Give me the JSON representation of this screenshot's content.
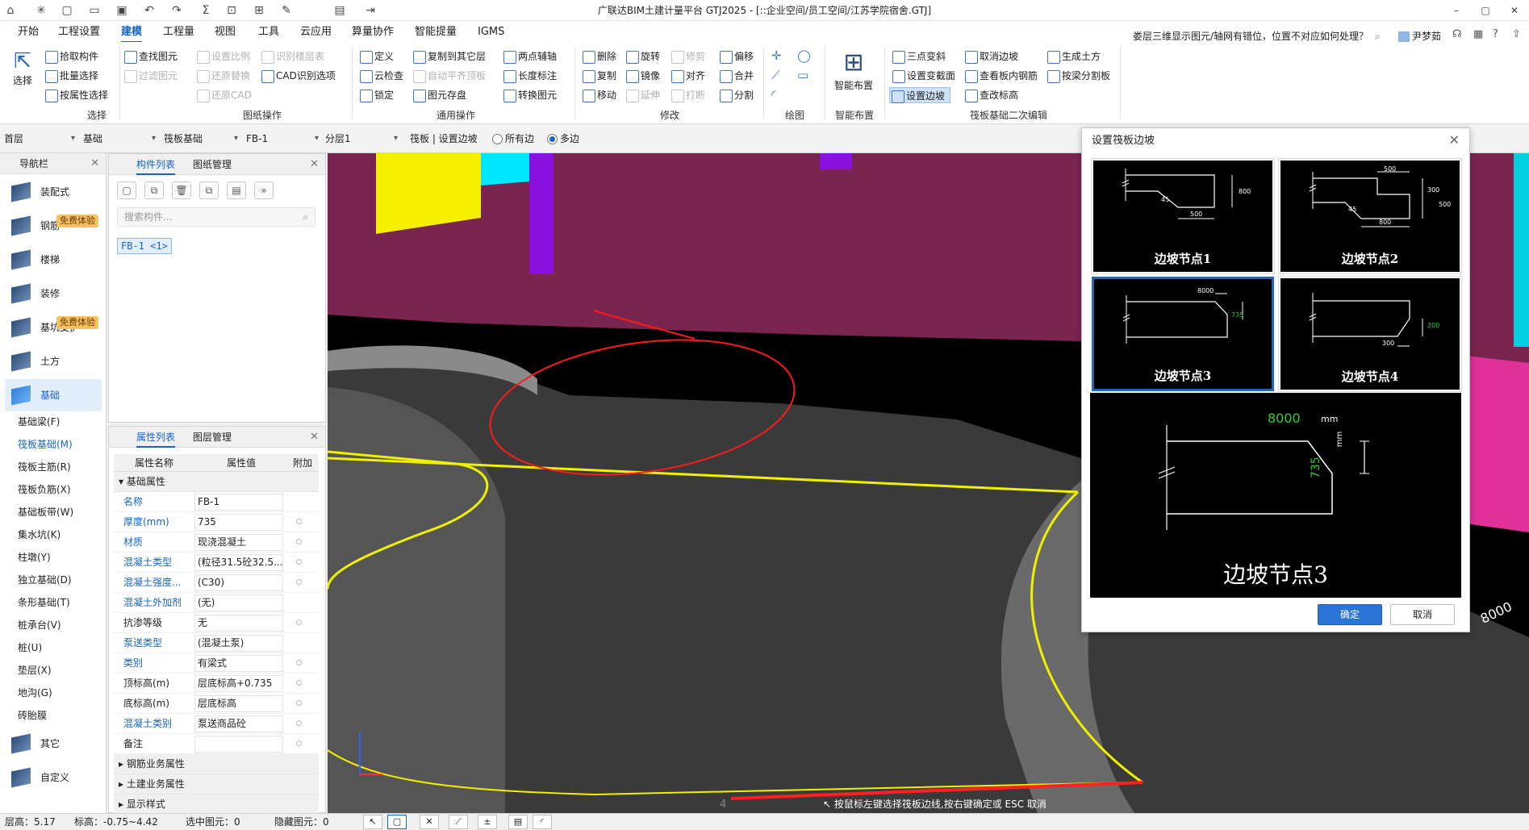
{
  "app": {
    "title": "广联达BIM土建计量平台 GTJ2025 - [::企业空间/员工空间/江苏学院宿舍.GTJ]"
  },
  "menu": {
    "tabs": [
      "开始",
      "工程设置",
      "建模",
      "工程量",
      "视图",
      "工具",
      "云应用",
      "算量协作",
      "智能提量",
      "IGMS"
    ],
    "active": "建模",
    "help": "娄层三维显示图元/轴网有错位，位置不对应如何处理？",
    "user": "尹梦茹"
  },
  "ribbon": {
    "select": {
      "big": "选择",
      "items": [
        "拾取构件",
        "批量选择",
        "按属性选择"
      ],
      "label": "选择"
    },
    "drawing": {
      "items": [
        "查找图元",
        "过滤图元",
        "设置比例",
        "还原替换",
        "还原CAD",
        "识别楼层表",
        "CAD识别选项"
      ],
      "label": "图纸操作"
    },
    "common": {
      "items": [
        "定义",
        "云检查",
        "锁定",
        "复制到其它层",
        "自动平齐顶板",
        "图元存盘",
        "两点辅轴",
        "长度标注",
        "转换图元"
      ],
      "label": "通用操作"
    },
    "modify": {
      "items": [
        "删除",
        "旋转",
        "修剪",
        "偏移",
        "复制",
        "镜像",
        "对齐",
        "合并",
        "移动",
        "延伸",
        "打断",
        "分割"
      ],
      "label": "修改"
    },
    "draw": {
      "label": "绘图"
    },
    "smart": {
      "big": "智能布置",
      "label": "智能布置"
    },
    "raft": {
      "items": [
        "三点变斜",
        "设置变截面",
        "设置边坡",
        "取消边坡",
        "查看板内钢筋",
        "查改标高",
        "生成土方",
        "按梁分割板"
      ],
      "label": "筏板基础二次编辑"
    }
  },
  "selbar": {
    "floor": "首层",
    "type": "基础",
    "subtype": "筏板基础",
    "comp": "FB-1",
    "layer": "分层1",
    "mode": "筏板 | 设置边坡",
    "opt_all": "所有边",
    "opt_multi": "多边"
  },
  "nav": {
    "title": "导航栏",
    "categories": [
      "装配式",
      "钢筋",
      "楼梯",
      "装修",
      "基坑支护",
      "土方",
      "基础",
      "其它",
      "自定义"
    ],
    "badge": "免费体验",
    "items": [
      "基础梁(F)",
      "筏板基础(M)",
      "筏板主筋(R)",
      "筏板负筋(X)",
      "基础板带(W)",
      "集水坑(K)",
      "柱墩(Y)",
      "独立基础(D)",
      "条形基础(T)",
      "桩承台(V)",
      "桩(U)",
      "垫层(X)",
      "地沟(G)",
      "砖胎膜"
    ],
    "active_item": "筏板基础(M)"
  },
  "components": {
    "tab1": "构件列表",
    "tab2": "图纸管理",
    "search_placeholder": "搜索构件...",
    "item": "FB-1 <1>"
  },
  "properties": {
    "tab1": "属性列表",
    "tab2": "图层管理",
    "headers": [
      "属性名称",
      "属性值",
      "附加"
    ],
    "group_basic": "基础属性",
    "rows": [
      {
        "name": "名称",
        "value": "FB-1"
      },
      {
        "name": "厚度(mm)",
        "value": "735"
      },
      {
        "name": "材质",
        "value": "现浇混凝土"
      },
      {
        "name": "混凝土类型",
        "value": "(粒径31.5砼32.5..."
      },
      {
        "name": "混凝土强度...",
        "value": "(C30)"
      },
      {
        "name": "混凝土外加剂",
        "value": "(无)"
      },
      {
        "name": "抗渗等级",
        "value": "无"
      },
      {
        "name": "泵送类型",
        "value": "(混凝土泵)"
      },
      {
        "name": "类别",
        "value": "有梁式"
      },
      {
        "name": "顶标高(m)",
        "value": "层底标高+0.735"
      },
      {
        "name": "底标高(m)",
        "value": "层底标高"
      },
      {
        "name": "混凝土类别",
        "value": "泵送商品砼"
      },
      {
        "name": "备注",
        "value": ""
      }
    ],
    "groups_bottom": [
      "钢筋业务属性",
      "土建业务属性",
      "显示样式"
    ]
  },
  "viewport": {
    "hint": "按鼠标左键选择筏板边线,按右键确定或 ESC 取消",
    "dim": "8000",
    "axis_label": "4"
  },
  "status": {
    "floor_h": "层高：5.17",
    "elev": "标高：-0.75~4.42",
    "selected": "选中图元：0",
    "hidden": "隐藏图元：0"
  },
  "dialog": {
    "title": "设置筏板边坡",
    "nodes": [
      "边坡节点1",
      "边坡节点2",
      "边坡节点3",
      "边坡节点4"
    ],
    "selected": "边坡节点3",
    "preview_caption": "边坡节点3",
    "preview_width": "8000",
    "preview_height": "735",
    "unit": "mm",
    "n1_angle": "45",
    "n1_w": "500",
    "n1_h": "800",
    "n2_w1": "500",
    "n2_angle": "45",
    "n2_w2": "800",
    "n2_h1": "300",
    "n2_h2": "500",
    "n3_w": "8000",
    "n3_h": "735",
    "n4_w": "300",
    "n4_h": "200",
    "ok": "确定",
    "cancel": "取消"
  }
}
